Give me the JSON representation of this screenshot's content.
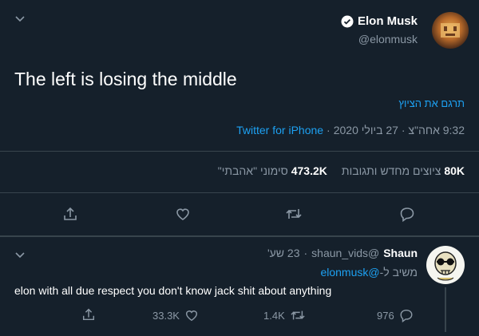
{
  "tweet": {
    "author_name": "Elon Musk",
    "author_handle": "@elonmusk",
    "text": "The left is losing the middle",
    "translate_label": "תרגם את הציוץ",
    "time": "9:32 אחה\"צ · 27 ביולי 2020",
    "source": "Twitter for iPhone",
    "retweets_count": "80K",
    "retweets_label": "ציוצים מחדש ותגובות",
    "likes_count": "473.2K",
    "likes_label": "סימוני \"אהבתי\""
  },
  "reply": {
    "author_name": "Shaun",
    "author_handle": "@shaun_vids",
    "time": "23 שע'",
    "replying_prefix": "משיב ל-",
    "replying_to": "@elonmusk",
    "text": "elon with all due respect you don't know jack shit about anything",
    "share_count": "",
    "like_count": "33.3K",
    "retweet_count": "1.4K",
    "reply_count": "976"
  },
  "icons": {
    "verified": "verified-badge-icon",
    "caret": "chevron-down-icon",
    "share": "share-icon",
    "like": "heart-icon",
    "retweet": "retweet-icon",
    "reply": "reply-icon"
  }
}
